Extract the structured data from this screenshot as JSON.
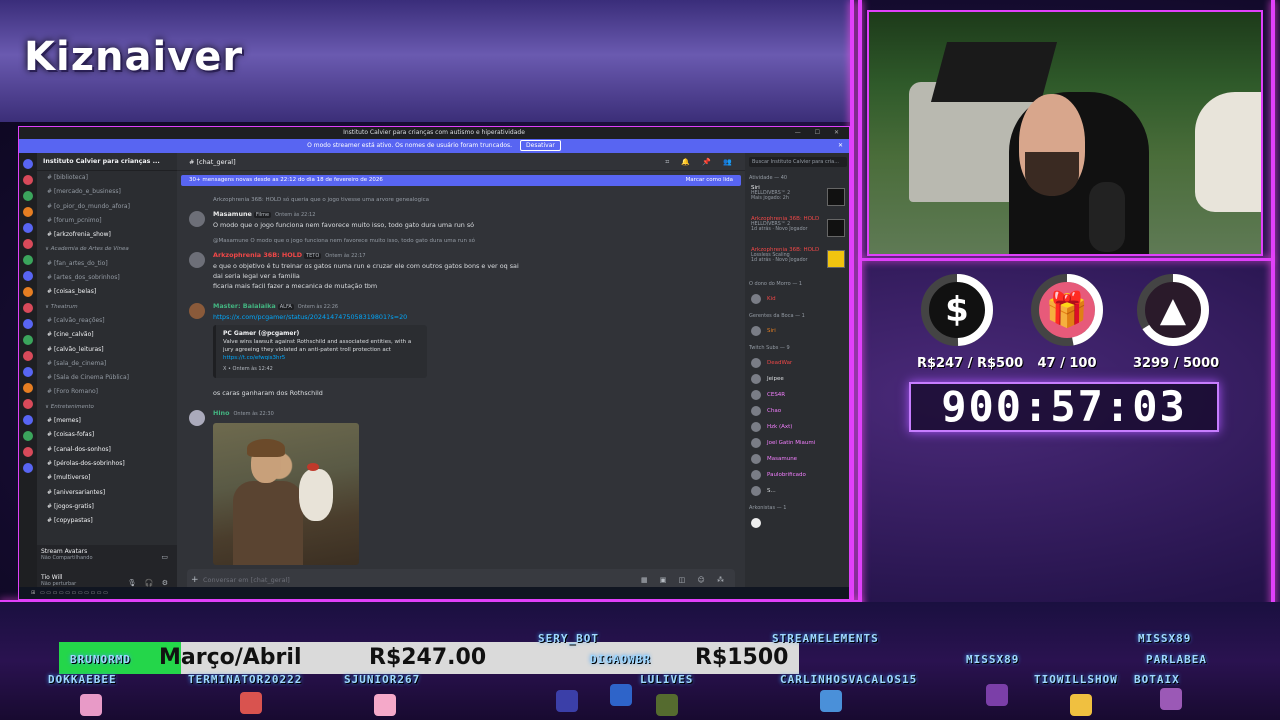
{
  "overlay": {
    "streamer_name": "Kiznaiver"
  },
  "discord": {
    "window_title": "Instituto Calvier para crianças com autismo e hiperatividade",
    "banner_text": "O modo streamer está ativo. Os nomes de usuário foram truncados.",
    "banner_button": "Desativar",
    "guild_name": "Instituto Calvier para crianças ...",
    "channels": [
      "[biblioteca]",
      "[mercado_e_business]",
      "[o_pior_do_mundo_afora]",
      "[forum_pcnimo]",
      "[arkzofrenia_show]",
      "Academia de Artes de Vinea",
      "[fan_artes_do_tio]",
      "[artes_dos_sobrinhos]",
      "[coisas_belas]",
      "Theatrum",
      "[calvão_reações]",
      "[cine_calvão]",
      "[calvão_leituras]",
      "[sala_de_cinema]",
      "[Sala de Cinema Pública]",
      "[Foro Romano]",
      "Entretenimento",
      "[memes]",
      "[coisas-fofas]",
      "[canal-dos-sonhos]",
      "[pérolas-dos-sobrinhos]",
      "[multiverso]",
      "[aniversariantes]",
      "[jogos-gratis]",
      "[copypastas]"
    ],
    "user_panel": {
      "app_name": "Stream Avatars",
      "app_status": "Não Compartilhando",
      "user_name": "Tio Will",
      "user_status": "Não perturbar"
    },
    "channel_title": "[chat_geral]",
    "new_messages_text": "30+ mensagens novas desde as 22:12 do dia 18 de fevereiro de 2026",
    "mark_read": "Marcar como lida",
    "messages": {
      "m0_reply": "Arkzophrenia 36B: HOLD  só queria que o jogo tivesse uma arvore genealogica",
      "m1_user": "Masamune",
      "m1_tag": "Filme",
      "m1_time": "Ontem às 22:12",
      "m1_text": "O modo que o jogo funciona nem favorece muito isso, todo gato dura uma run só",
      "m2_reply": "@Masamune  O modo que o jogo funciona nem favorece muito isso, todo gato dura uma run só",
      "m2_user": "Arkzophrenia 36B: HOLD",
      "m2_tag": "TETO",
      "m2_time": "Ontem às 22:17",
      "m2_text1": "e que o objetivo é tu treinar os gatos numa run e cruzar ele com outros gatos bons e ver oq sai",
      "m2_text2": "dai seria legal ver a familia",
      "m2_text3": "ficaria mais facil fazer a mecanica de mutação tbm",
      "m3_user": "Master: Balalaika",
      "m3_tag": "ALFA",
      "m3_time": "Ontem às 22:26",
      "m3_link": "https://x.com/pcgamer/status/2024147475058319801?s=20",
      "embed_author": "PC Gamer (@pcgamer)",
      "embed_text": "Valve wins lawsuit against Rothschild and associated entities, with a jury agreeing they violated an anti-patent troll protection act",
      "embed_link": "https://t.co/efwqis3hr5",
      "embed_footer": "X • Ontem às 12:42",
      "m3_text": "os caras ganharam dos Rothschild",
      "m4_user": "Hino",
      "m4_time": "Ontem às 22:30"
    },
    "composer_placeholder": "Conversar em",
    "composer_channel": "[chat_geral]",
    "members_search": "Buscar Instituto Calvier para cria...",
    "members": {
      "activity_header": "Atividade — 40",
      "activities": [
        {
          "user": "Siri",
          "game": "HELLDIVERS™ 2",
          "detail": "Mais jogado: 2h"
        },
        {
          "user": "Arkzophrenia 36B: HOLD",
          "game": "HELLDIVERS™ 2",
          "detail": "1d atrás · Novo Jogador"
        },
        {
          "user": "Arkzophrenia 36B: HOLD",
          "game": "Lossless Scaling",
          "detail": "1d atrás · Novo Jogador"
        }
      ],
      "group1": "O dono do Morro — 1",
      "group1_members": [
        "Kid"
      ],
      "group2": "Gerentes da Boca — 1",
      "group2_members": [
        "Siri"
      ],
      "group3": "Twitch Subs — 9",
      "group3_members": [
        "DeadWar",
        "Jeipee",
        "CES4R",
        "Chao",
        "Hzk (Axt)",
        "Joel Gatin Miaumi",
        "Masamune",
        "Paulobrificado",
        "S..."
      ],
      "group4": "Arkonistas — 1"
    }
  },
  "stats": {
    "goal1": {
      "icon": "$",
      "text": "R$247 / R$500",
      "progress": 0.494
    },
    "goal2": {
      "icon": "🎁",
      "text": "47 / 100",
      "progress": 0.47
    },
    "goal3": {
      "icon": "▲",
      "text": "3299 / 5000",
      "progress": 0.66
    },
    "timer": "900:57:03"
  },
  "ticker": {
    "goal_label": "Março/Abril",
    "goal_current": "R$247.00",
    "goal_target": "R$1500",
    "goal_progress": 0.165,
    "chatters": [
      "SERY_BOT",
      "STREAMELEMENTS",
      "MISSX89",
      "BRUNORMD",
      "DIGAOWBR",
      "MISSX89",
      "PARLABEA",
      "DOKKAEBEE",
      "TERMINATOR20222",
      "SJUNIOR267",
      "LULIVES",
      "CARLINHOSVACALOS15",
      "TIOWILLSHOW",
      "BOTAIX"
    ]
  }
}
